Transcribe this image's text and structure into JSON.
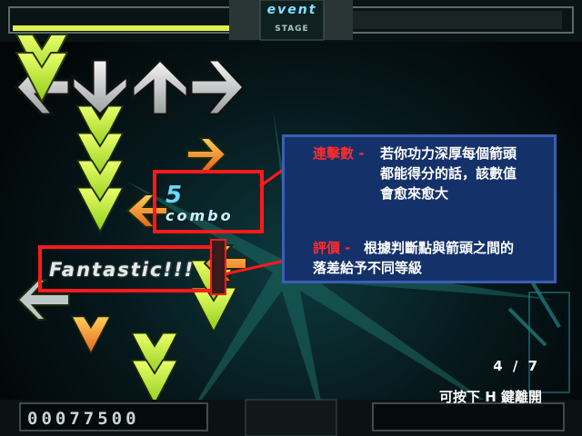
{
  "top_bar": {
    "mode": "event",
    "stage_label": "STAGE"
  },
  "combo": {
    "count": "5",
    "word": "combo"
  },
  "judgement": {
    "text": "Fantastic!!!"
  },
  "tips": {
    "combo_heading": "連擊數 -",
    "combo_line1": "若你功力深厚每個箭頭",
    "combo_line2": "都能得分的話，該數值",
    "combo_line3": "會愈來愈大",
    "judge_heading": "評價 -",
    "judge_line1": "根據判斷點與箭頭之間的",
    "judge_line2": "落差給予不同等級"
  },
  "page_indicator": "4 / 7",
  "exit_hint": "可按下 H 鍵離開",
  "score": "00077500",
  "colors": {
    "highlight": "#ff1a1a",
    "tip_bg": "#14316a",
    "tip_border": "#3a5fb2",
    "arrow_green": "#c6f23a",
    "arrow_orange": "#ff9a2a"
  }
}
